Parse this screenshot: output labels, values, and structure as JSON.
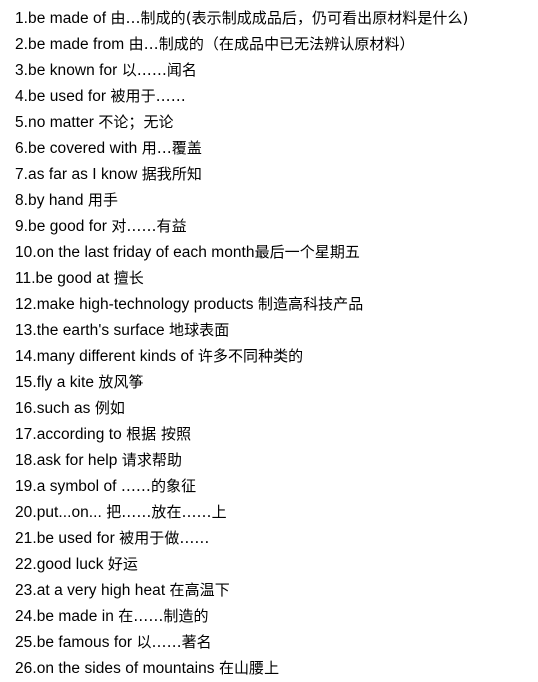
{
  "document": {
    "title": "English Phrases with Chinese Translations",
    "background_color": "#ffffff",
    "text_color": "#000000",
    "item_count": 26
  },
  "phrases": [
    {
      "number": "1.",
      "english": "be made of ",
      "chinese": "由…制成的(表示制成成品后，仍可看出原材料是什么)"
    },
    {
      "number": "2.",
      "english": "be made from ",
      "chinese": "由…制成的（在成品中已无法辨认原材料）"
    },
    {
      "number": "3.",
      "english": "be known for ",
      "chinese": "以……闻名"
    },
    {
      "number": "4.",
      "english": "be used for ",
      "chinese": "被用于……"
    },
    {
      "number": "5.",
      "english": "no matter ",
      "chinese": "不论；无论"
    },
    {
      "number": "6.",
      "english": "be covered with ",
      "chinese": "用…覆盖"
    },
    {
      "number": "7.",
      "english": "as far as I know ",
      "chinese": "据我所知"
    },
    {
      "number": "8.",
      "english": "by hand ",
      "chinese": "用手"
    },
    {
      "number": "9.",
      "english": "be good for ",
      "chinese": "对……有益"
    },
    {
      "number": "10.",
      "english": "on the last friday of each month",
      "chinese": "最后一个星期五"
    },
    {
      "number": "11.",
      "english": "be good at ",
      "chinese": "擅长"
    },
    {
      "number": "12.",
      "english": "make high-technology products ",
      "chinese": "制造高科技产品"
    },
    {
      "number": "13.",
      "english": "the earth's surface ",
      "chinese": "地球表面"
    },
    {
      "number": "14.",
      "english": "many different kinds of ",
      "chinese": "许多不同种类的"
    },
    {
      "number": "15.",
      "english": "fly a kite ",
      "chinese": "放风筝"
    },
    {
      "number": "16.",
      "english": "such as ",
      "chinese": "例如"
    },
    {
      "number": "17.",
      "english": "according to ",
      "chinese": "根据 按照"
    },
    {
      "number": "18.",
      "english": "ask for help ",
      "chinese": "请求帮助"
    },
    {
      "number": "19.",
      "english": "a symbol of ",
      "chinese": "……的象征"
    },
    {
      "number": "20.",
      "english": "put...on... ",
      "chinese": "把……放在……上"
    },
    {
      "number": "21.",
      "english": "be used for ",
      "chinese": "被用于做……"
    },
    {
      "number": "22.",
      "english": "good luck ",
      "chinese": "好运"
    },
    {
      "number": "23.",
      "english": "at a very high heat ",
      "chinese": "在高温下"
    },
    {
      "number": "24.",
      "english": "be made in ",
      "chinese": "在……制造的"
    },
    {
      "number": "25.",
      "english": "be famous for ",
      "chinese": "以……著名"
    },
    {
      "number": "26.",
      "english": "on the sides of mountains ",
      "chinese": "在山腰上"
    }
  ]
}
